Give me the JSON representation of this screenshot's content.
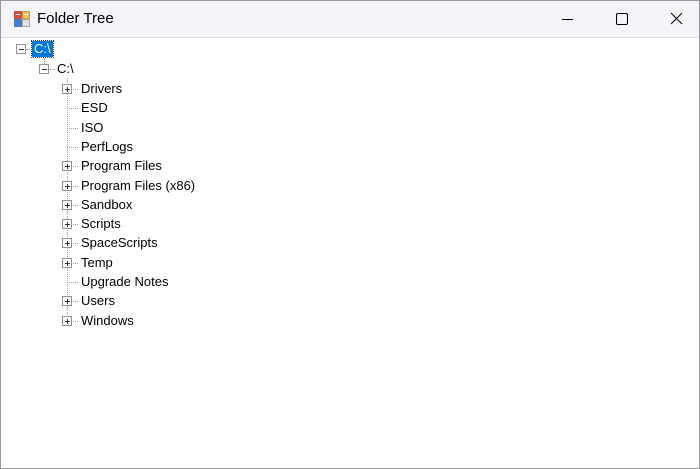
{
  "window": {
    "title": "Folder Tree",
    "app_icon": "folder-tree-app-icon",
    "controls": {
      "minimize_icon": "minimize-icon",
      "maximize_icon": "maximize-icon",
      "close_icon": "close-icon"
    }
  },
  "tree": {
    "root": {
      "label": "C:\\",
      "selected": true,
      "expanded": true
    },
    "drive": {
      "label": "C:\\",
      "expanded": true
    },
    "children": [
      {
        "label": "Drivers",
        "has_children": true
      },
      {
        "label": "ESD",
        "has_children": false
      },
      {
        "label": "ISO",
        "has_children": false
      },
      {
        "label": "PerfLogs",
        "has_children": false
      },
      {
        "label": "Program Files",
        "has_children": true
      },
      {
        "label": "Program Files (x86)",
        "has_children": true
      },
      {
        "label": "Sandbox",
        "has_children": true
      },
      {
        "label": "Scripts",
        "has_children": true
      },
      {
        "label": "SpaceScripts",
        "has_children": true
      },
      {
        "label": "Temp",
        "has_children": true
      },
      {
        "label": "Upgrade Notes",
        "has_children": false
      },
      {
        "label": "Users",
        "has_children": true
      },
      {
        "label": "Windows",
        "has_children": true
      }
    ],
    "colors": {
      "selection": "#0078d7",
      "lines": "#a0a0a0"
    }
  }
}
